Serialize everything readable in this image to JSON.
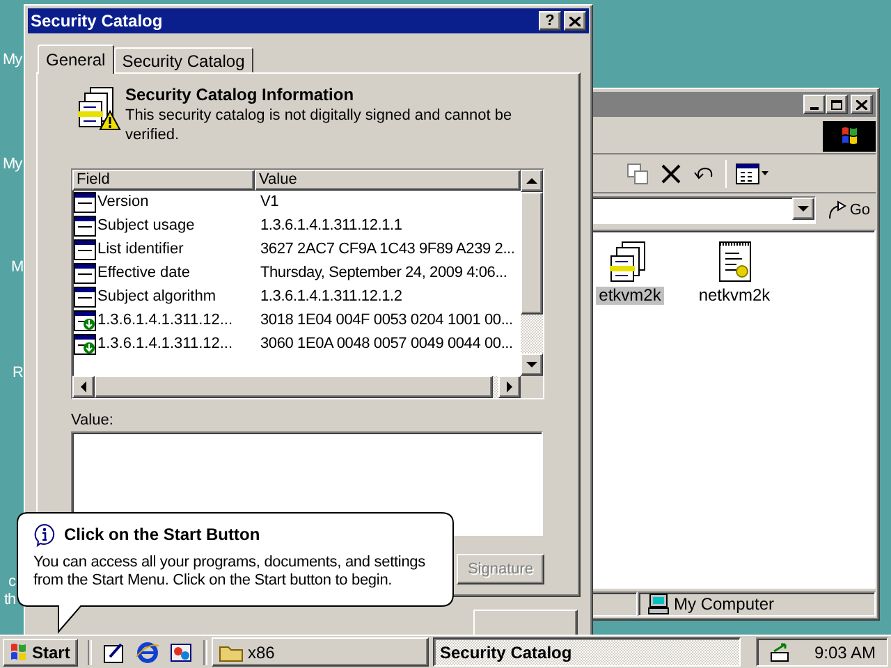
{
  "desktop": {
    "icon_labels": [
      "My",
      "My",
      "M",
      "R",
      "c",
      "th"
    ]
  },
  "dialog": {
    "title": "Security Catalog",
    "help": "?",
    "tabs": [
      {
        "label": "General",
        "selected": true
      },
      {
        "label": "Security Catalog",
        "selected": false
      }
    ],
    "header": {
      "title": "Security Catalog Information",
      "description": "This security catalog is not digitally signed and cannot be verified."
    },
    "list": {
      "columns": [
        "Field",
        "Value"
      ],
      "rows": [
        {
          "kind": "field",
          "field": "Version",
          "value": "V1"
        },
        {
          "kind": "field",
          "field": "Subject usage",
          "value": "1.3.6.1.4.1.311.12.1.1"
        },
        {
          "kind": "field",
          "field": "List identifier",
          "value": "3627 2AC7 CF9A 1C43 9F89 A239 2..."
        },
        {
          "kind": "field",
          "field": "Effective date",
          "value": "Thursday, September 24, 2009 4:06..."
        },
        {
          "kind": "field",
          "field": "Subject algorithm",
          "value": "1.3.6.1.4.1.311.12.1.2"
        },
        {
          "kind": "extension",
          "field": "1.3.6.1.4.1.311.12...",
          "value": "3018 1E04 004F 0053 0204 1001 00..."
        },
        {
          "kind": "extension",
          "field": "1.3.6.1.4.1.311.12...",
          "value": "3060 1E0A 0048 0057 0049 0044 00..."
        }
      ]
    },
    "value_label": "Value:",
    "signature_button": {
      "label": "Signature",
      "disabled": true
    }
  },
  "explorer": {
    "go": "Go",
    "items": [
      {
        "kind": "catalog",
        "label": "etkvm2k",
        "selected": true
      },
      {
        "kind": "setup",
        "label": "netkvm2k",
        "selected": false
      }
    ],
    "status": "My Computer"
  },
  "balloon": {
    "title": "Click on the Start Button",
    "body": "You can access all your programs, documents, and settings from the Start Menu. Click on the Start button to begin."
  },
  "taskbar": {
    "start": "Start",
    "tasks": [
      {
        "label": "x86",
        "selected": false
      },
      {
        "label": "Security Catalog",
        "selected": true
      }
    ],
    "clock": "9:03 AM"
  }
}
